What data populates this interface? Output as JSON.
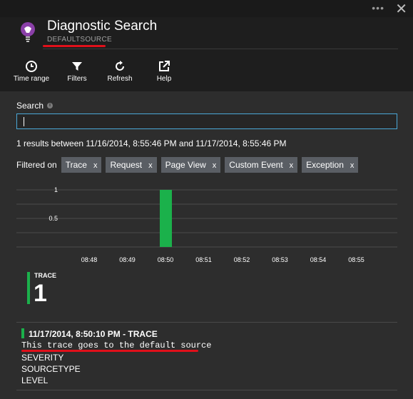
{
  "header": {
    "title": "Diagnostic Search",
    "subtitle": "DEFAULTSOURCE",
    "more_glyph": "•••",
    "close_glyph": "✕",
    "app_icon": "lightbulb-icon"
  },
  "toolbar": [
    {
      "label": "Time range",
      "icon": "clock-icon"
    },
    {
      "label": "Filters",
      "icon": "filter-icon"
    },
    {
      "label": "Refresh",
      "icon": "refresh-icon"
    },
    {
      "label": "Help",
      "icon": "external-link-icon"
    }
  ],
  "search": {
    "label": "Search",
    "info": "i",
    "value": "",
    "placeholder": ""
  },
  "results_text": "1 results between 11/16/2014, 8:55:46 PM and 11/17/2014, 8:55:46 PM",
  "filters": {
    "label": "Filtered on",
    "chips": [
      "Trace",
      "Request",
      "Page View",
      "Custom Event",
      "Exception"
    ],
    "remove_glyph": "x"
  },
  "chart_data": {
    "type": "bar",
    "categories": [
      "08:48",
      "08:49",
      "08:50",
      "08:51",
      "08:52",
      "08:53",
      "08:54",
      "08:55"
    ],
    "values": [
      0,
      0,
      1,
      0,
      0,
      0,
      0,
      0
    ],
    "bar_position_minutes": 50,
    "y_ticks": [
      "1",
      "0.5"
    ],
    "ylim": [
      0,
      1
    ],
    "grid": true,
    "series_color": "#1bb14b"
  },
  "kpi": {
    "label": "TRACE",
    "value": "1",
    "color": "#1bb14b"
  },
  "result_item": {
    "title": "11/17/2014, 8:50:10 PM - TRACE",
    "message": "This trace goes to the default source",
    "fields": [
      "SEVERITY",
      "SOURCETYPE",
      "LEVEL"
    ]
  },
  "colors": {
    "annotation_underline": "#e0101a",
    "accent_blue": "#4aa8d8",
    "chip_bg": "#5a5e64"
  }
}
